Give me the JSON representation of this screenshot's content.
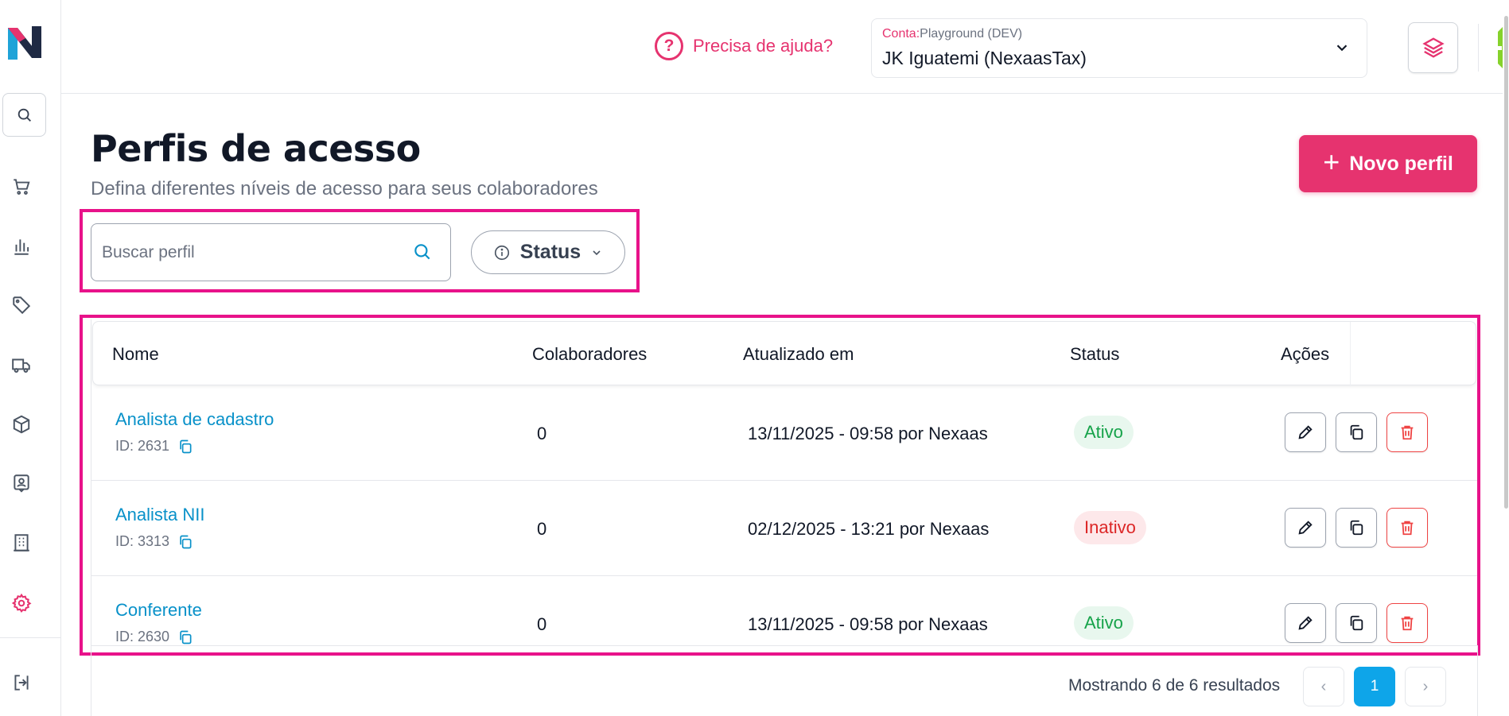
{
  "header": {
    "help_text": "Precisa de ajuda?",
    "account_prefix": "Conta:",
    "account_env": "Playground (DEV)",
    "account_name": "JK Iguatemi (NexaasTax)"
  },
  "sidebar": {
    "items": [
      {
        "icon": "search-icon"
      },
      {
        "icon": "cart-icon"
      },
      {
        "icon": "chart-icon"
      },
      {
        "icon": "tag-icon"
      },
      {
        "icon": "truck-icon"
      },
      {
        "icon": "box-icon"
      },
      {
        "icon": "contact-icon"
      },
      {
        "icon": "building-icon"
      },
      {
        "icon": "gear-icon",
        "active": true
      },
      {
        "icon": "logout-icon"
      }
    ]
  },
  "page": {
    "title": "Perfis de acesso",
    "subtitle": "Defina diferentes níveis de acesso para seus colaboradores",
    "new_button": "Novo perfil"
  },
  "filters": {
    "search_placeholder": "Buscar perfil",
    "status_label": "Status"
  },
  "table": {
    "columns": [
      "Nome",
      "Colaboradores",
      "Atualizado em",
      "Status",
      "Ações"
    ],
    "rows": [
      {
        "name": "Analista de cadastro",
        "id": "ID: 2631",
        "collaborators": "0",
        "updated": "13/11/2025 - 09:58 por Nexaas",
        "status": "Ativo"
      },
      {
        "name": "Analista NII",
        "id": "ID: 3313",
        "collaborators": "0",
        "updated": "02/12/2025 - 13:21 por Nexaas",
        "status": "Inativo"
      },
      {
        "name": "Conferente",
        "id": "ID: 2630",
        "collaborators": "0",
        "updated": "13/11/2025 - 09:58 por Nexaas",
        "status": "Ativo"
      }
    ]
  },
  "pagination": {
    "results_text": "Mostrando 6 de 6 resultados",
    "current_page": "1",
    "prev": "‹",
    "next": "›"
  },
  "colors": {
    "accent": "#e6336f",
    "link": "#0891c9",
    "primary_blue": "#0ea5e9",
    "highlight_frame": "#e8128a"
  }
}
